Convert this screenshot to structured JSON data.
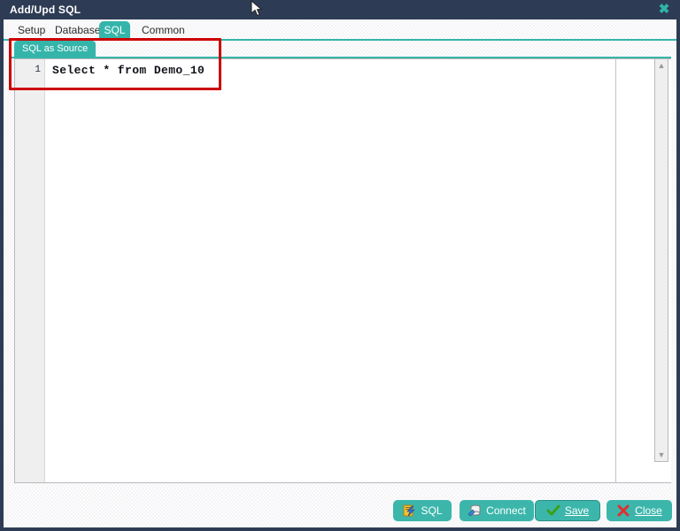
{
  "window": {
    "title": "Add/Upd SQL",
    "close_glyph": "✖",
    "accent_color": "#35b5aa",
    "titlebar_color": "#2d3c54",
    "annotation_color": "#cc0000"
  },
  "tabs": [
    {
      "label": "Setup",
      "active": false
    },
    {
      "label": "Database",
      "active": false
    },
    {
      "label": "SQL",
      "active": true
    },
    {
      "label": "Common",
      "active": false
    }
  ],
  "panel": {
    "sub_tab_label": "SQL as Source"
  },
  "editor": {
    "line_number": "1",
    "code": "Select * from Demo_10"
  },
  "scrollbars": {
    "vertical": {
      "up_glyph": "▲",
      "down_glyph": "▼"
    },
    "horizontal": {
      "left_glyph": "‹",
      "right_glyph": "›"
    }
  },
  "footer": {
    "buttons": [
      {
        "label": "SQL",
        "icon": "sql-lightning-icon",
        "focused": false
      },
      {
        "label": "Connect",
        "icon": "database-connect-icon",
        "focused": false
      },
      {
        "label": "Save",
        "icon": "green-check-icon",
        "focused": true
      },
      {
        "label": "Close",
        "icon": "red-cross-icon",
        "focused": false
      }
    ]
  }
}
